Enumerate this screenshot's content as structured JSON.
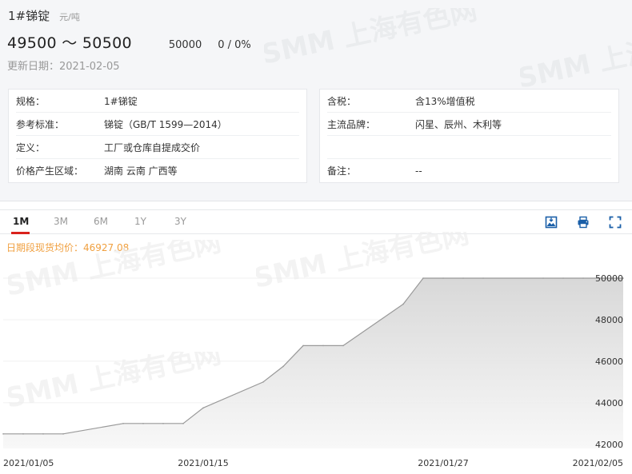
{
  "product": {
    "name": "1#锑锭",
    "unit": "元/吨",
    "price_range": "49500 ～ 50500",
    "average": "50000",
    "change": "0 / 0%",
    "updated": "更新日期：2021-02-05"
  },
  "info_left": [
    {
      "label": "规格：",
      "value": "1#锑锭"
    },
    {
      "label": "参考标准：",
      "value": "锑锭（GB/T 1599—2014）"
    },
    {
      "label": "定义：",
      "value": "工厂或仓库自提成交价"
    },
    {
      "label": "价格产生区域：",
      "value": "湖南 云南 广西等"
    }
  ],
  "info_right": [
    {
      "label": "含税：",
      "value": "含13%增值税"
    },
    {
      "label": "主流品牌：",
      "value": "闪星、辰州、木利等"
    },
    {
      "label": "",
      "value": ""
    },
    {
      "label": "备注：",
      "value": "--"
    }
  ],
  "tabs": [
    "1M",
    "3M",
    "6M",
    "1Y",
    "3Y"
  ],
  "active_tab": "1M",
  "tools": [
    "image-download-icon",
    "printer-icon",
    "fullscreen-icon"
  ],
  "watermark": "SMM 上海有色网",
  "chart_data": {
    "type": "area",
    "legend_text": "日期段现货均价：46927.08",
    "x": [
      "2021/01/05",
      "2021/01/06",
      "2021/01/07",
      "2021/01/08",
      "2021/01/11",
      "2021/01/12",
      "2021/01/13",
      "2021/01/14",
      "2021/01/15",
      "2021/01/18",
      "2021/01/19",
      "2021/01/20",
      "2021/01/21",
      "2021/01/22",
      "2021/01/25",
      "2021/01/26",
      "2021/01/27",
      "2021/01/28",
      "2021/01/29",
      "2021/02/01",
      "2021/02/02",
      "2021/02/03",
      "2021/02/04",
      "2021/02/05"
    ],
    "values": [
      42500,
      42500,
      42500,
      42500,
      43000,
      43000,
      43000,
      43000,
      43750,
      45000,
      45750,
      46750,
      46750,
      46750,
      48750,
      50000,
      50000,
      50000,
      50000,
      50000,
      50000,
      50000,
      50000,
      50000
    ],
    "x_tick_labels": [
      "2021/01/05",
      "2021/01/15",
      "2021/01/27",
      "2021/02/05"
    ],
    "y_ticks": [
      42000,
      44000,
      46000,
      48000,
      50000
    ],
    "ylim": [
      41800,
      50500
    ],
    "grid": true,
    "colors": {
      "line": "#999999",
      "area_top": "#d6d6d6",
      "area_bottom": "#f7f7f7",
      "legend": "#f0a040",
      "tab_accent": "#d9221c",
      "tool_icon": "#1a5fa8"
    }
  }
}
